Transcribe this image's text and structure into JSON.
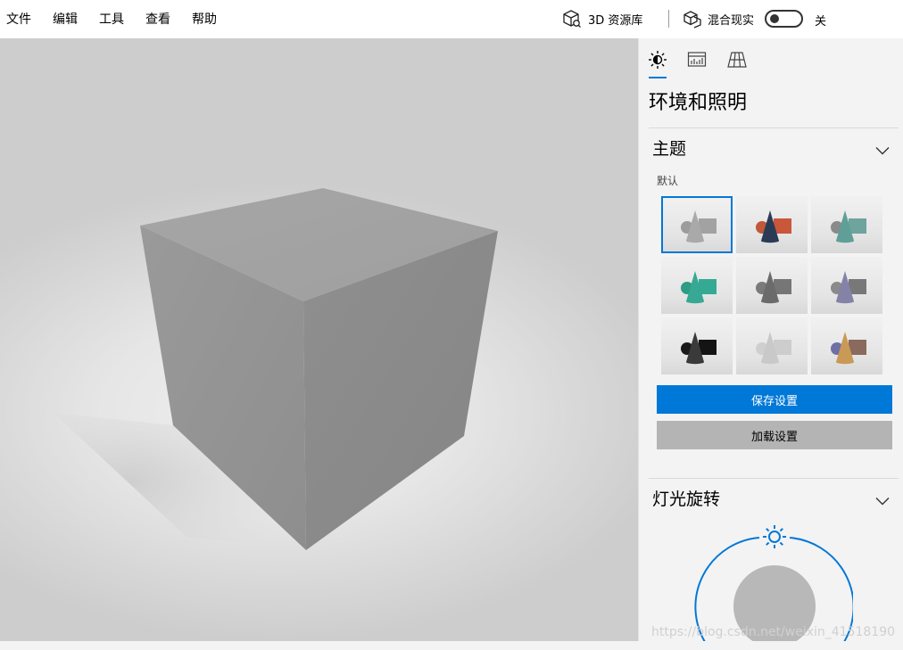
{
  "menu": {
    "items": [
      "文件",
      "编辑",
      "工具",
      "查看",
      "帮助"
    ]
  },
  "toolbar": {
    "library_label": "3D 资源库",
    "library_icon": "cube-library-icon",
    "mixed_reality_label": "混合现实",
    "mixed_reality_icon": "mixed-reality-icon",
    "toggle_state": "关"
  },
  "panel": {
    "tabs": [
      {
        "icon": "sun-icon",
        "selected": true
      },
      {
        "icon": "stats-icon",
        "selected": false
      },
      {
        "icon": "grid-icon",
        "selected": false
      }
    ],
    "title": "环境和照明",
    "theme_section": {
      "title": "主题",
      "default_label": "默认",
      "selected_index": 0,
      "themes": [
        {
          "cone": "#a9a9a9",
          "ball": "#9c9c9c",
          "box": "#a2a2a2"
        },
        {
          "cone": "#2b3b55",
          "ball": "#c0583a",
          "box": "#c9573a"
        },
        {
          "cone": "#5f9f98",
          "ball": "#8a8a8a",
          "box": "#6fa39d"
        },
        {
          "cone": "#36a893",
          "ball": "#2e9c84",
          "box": "#34aa94"
        },
        {
          "cone": "#6b6b6b",
          "ball": "#7a7a7a",
          "box": "#767676"
        },
        {
          "cone": "#8582a8",
          "ball": "#8a8a8a",
          "box": "#787878"
        },
        {
          "cone": "#3a3a3a",
          "ball": "#1a1a1a",
          "box": "#141414"
        },
        {
          "cone": "#c9c9c9",
          "ball": "#cfcfcf",
          "box": "#cdcdcd"
        },
        {
          "cone": "#c89a55",
          "ball": "#6f6fa8",
          "box": "#8a6a5c"
        }
      ],
      "save_label": "保存设置",
      "load_label": "加载设置"
    },
    "light_section": {
      "title": "灯光旋转"
    }
  },
  "watermark": "https://blog.csdn.net/weixin_41518190",
  "colors": {
    "accent": "#0078d7",
    "cube_top": "#a3a3a3",
    "cube_left": "#929292",
    "cube_right": "#8a8a8a"
  }
}
